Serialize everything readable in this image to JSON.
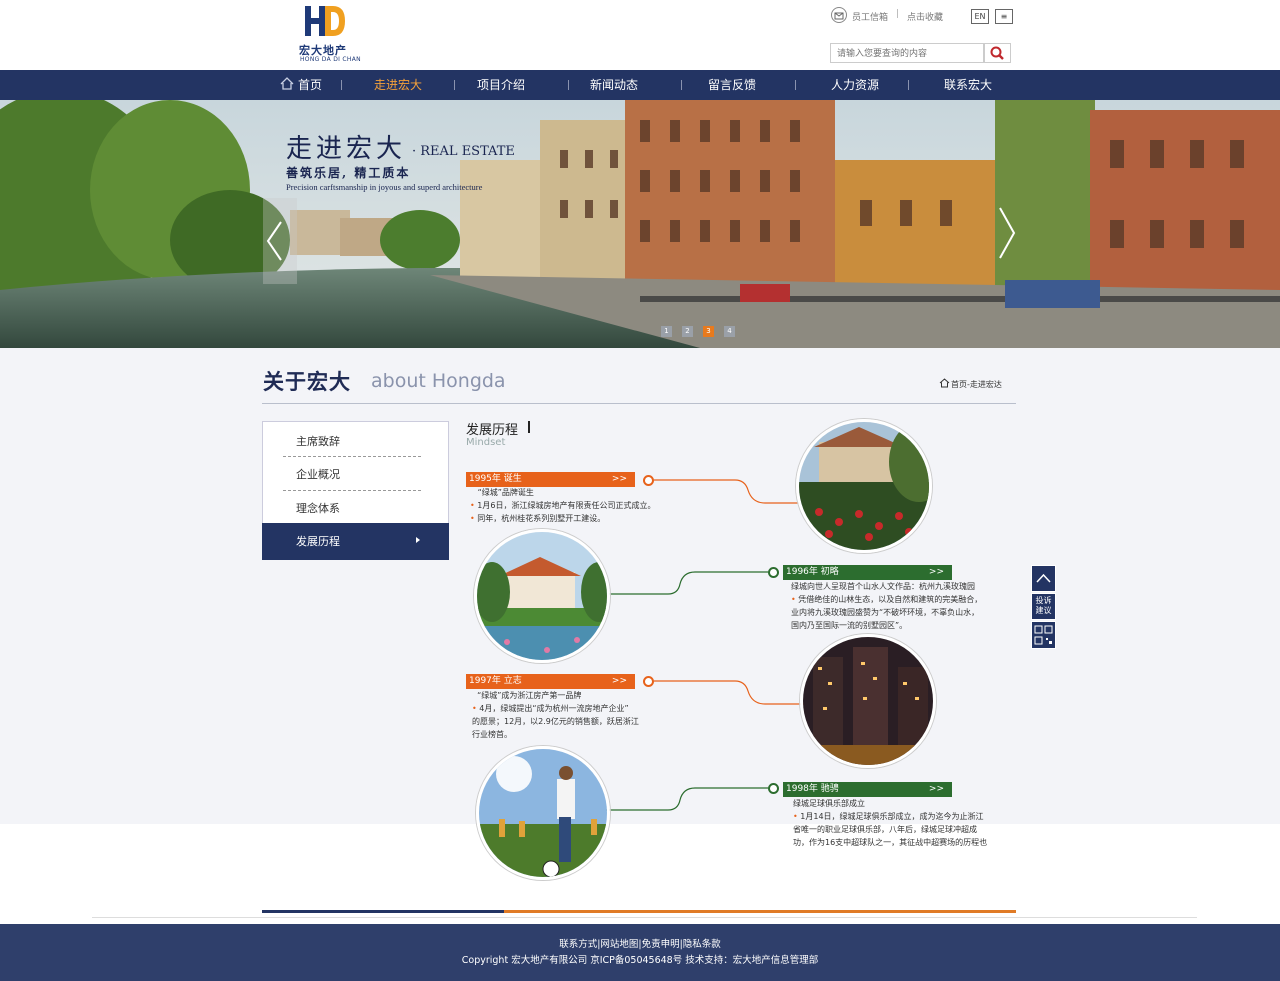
{
  "header": {
    "logo_cn": "宏大地产",
    "logo_en": "HONG DA DI CHAN",
    "staff_mail": "员工信箱",
    "separator": "|",
    "bookmark": "点击收藏",
    "lang": "EN",
    "menu_icon": "≡",
    "search_placeholder": "请输入您要查询的内容"
  },
  "nav": {
    "items": [
      "首页",
      "走进宏大",
      "项目介绍",
      "新闻动态",
      "留言反馈",
      "人力资源",
      "联系宏大"
    ],
    "active_index": 1
  },
  "banner": {
    "title": "走进宏大",
    "title_en": "· REAL ESTATE",
    "subtitle": "善筑乐居, 精工质本",
    "subtitle_en": "Precision carftsmanship in joyous and superd architecture",
    "dots": [
      "1",
      "2",
      "3",
      "4"
    ],
    "active_dot": 2
  },
  "section": {
    "title": "关于宏大",
    "title_en": "about Hongda",
    "breadcrumb": "首页-走进宏达"
  },
  "sidebar": {
    "items": [
      "主席致辞",
      "企业概况",
      "理念体系"
    ],
    "active": "发展历程"
  },
  "history": {
    "title": "发展历程",
    "title_en": "Mindset",
    "entries": [
      {
        "tag": "1995年 诞生",
        "chev": ">>",
        "lines": [
          "“绿城”品牌诞生",
          "1月6日，浙江绿城房地产有限责任公司正式成立。",
          "同年，杭州桂花系列别墅开工建设。"
        ]
      },
      {
        "tag": "1996年 初略",
        "chev": ">>",
        "lines": [
          "绿城向世人呈现首个山水人文作品：杭州九溪玫瑰园",
          "凭借绝佳的山林生态，以及自然和建筑的完美融合，",
          "业内将九溪玫瑰园盛赞为“不破坏环境，不辜负山水，",
          "国内乃至国际一流的别墅园区”。"
        ]
      },
      {
        "tag": "1997年 立志",
        "chev": ">>",
        "lines": [
          "“绿城”成为浙江房产第一品牌",
          "4月，绿城提出“成为杭州一流房地产企业”",
          "的愿景；12月，以2.9亿元的销售额，跃居浙江",
          "行业榜首。"
        ]
      },
      {
        "tag": "1998年 驰骋",
        "chev": ">>",
        "lines": [
          "绿城足球俱乐部成立",
          "1月14日，绿城足球俱乐部成立，成为迄今为止浙江",
          "省唯一的职业足球俱乐部，八年后，绿城足球冲超成",
          "功，作为16支中超球队之一，其征战中超赛场的历程也"
        ]
      }
    ]
  },
  "float": {
    "top_icon": "arrow-up-icon",
    "complaint": "投诉建议",
    "qr_icon": "qrcode-icon"
  },
  "footer": {
    "links": "联系方式|网站地图|免责申明|隐私条款",
    "copyright": "Copyright 宏大地产有限公司 京ICP备05045648号 技术支持：宏大地产信息管理部"
  },
  "colors": {
    "navy": "#233463",
    "orange": "#e7621b",
    "green": "#2c6d2f",
    "footer": "#2f3f6b"
  }
}
